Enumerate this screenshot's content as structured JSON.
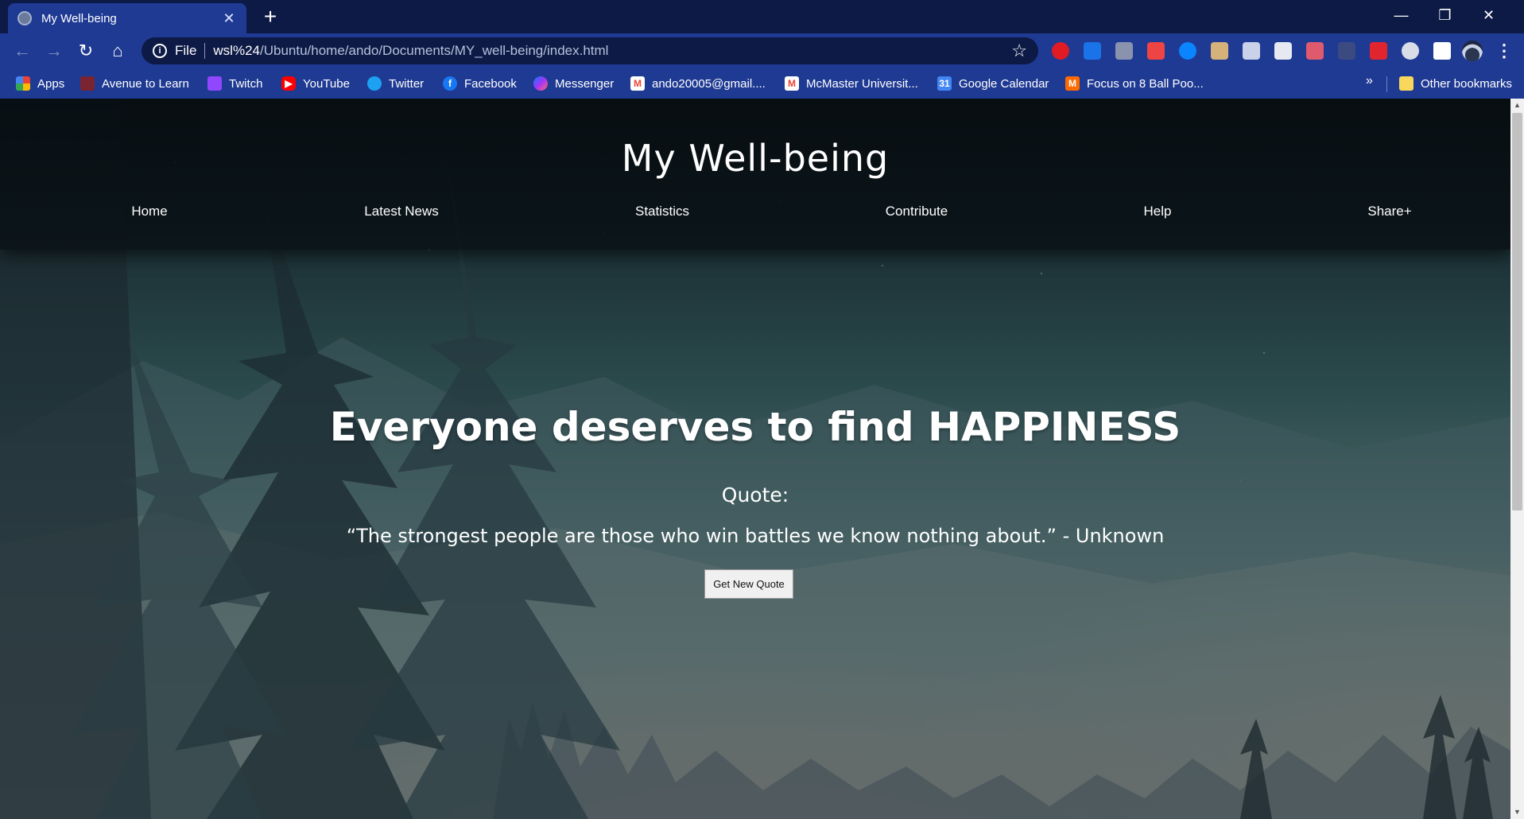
{
  "browser": {
    "tab_title": "My Well-being",
    "new_tab_symbol": "+",
    "url": {
      "scheme_label": "File",
      "host": "wsl%24",
      "path": "/Ubuntu/home/ando/Documents/MY_well-being/index.html"
    },
    "window_controls": {
      "minimize": "—",
      "restore": "❐",
      "close": "✕"
    },
    "bookmarks": [
      {
        "label": "Apps",
        "icon": "apps-grid-icon",
        "color": "#e8453c"
      },
      {
        "label": "Avenue to Learn",
        "icon": "avenue-icon",
        "color": "#7a2432"
      },
      {
        "label": "Twitch",
        "icon": "twitch-icon",
        "color": "#9146ff"
      },
      {
        "label": "YouTube",
        "icon": "youtube-icon",
        "color": "#ff0000"
      },
      {
        "label": "Twitter",
        "icon": "twitter-icon",
        "color": "#1da1f2"
      },
      {
        "label": "Facebook",
        "icon": "facebook-icon",
        "color": "#1877f2"
      },
      {
        "label": "Messenger",
        "icon": "messenger-icon",
        "color": "#a334fa"
      },
      {
        "label": "ando20005@gmail....",
        "icon": "gmail-icon",
        "color": "#ea4335"
      },
      {
        "label": "McMaster Universit...",
        "icon": "gmail-icon",
        "color": "#ea4335"
      },
      {
        "label": "Google Calendar",
        "icon": "calendar-icon",
        "color": "#4285f4"
      },
      {
        "label": "Focus on 8 Ball Poo...",
        "icon": "miniclip-icon",
        "color": "#ff6a00"
      }
    ],
    "bookmarks_overflow": "»",
    "other_bookmarks": "Other bookmarks"
  },
  "site": {
    "title": "My Well-being",
    "nav": [
      "Home",
      "Latest News",
      "Statistics",
      "Contribute",
      "Help",
      "Share+"
    ]
  },
  "hero": {
    "heading": "Everyone deserves to find HAPPINESS",
    "quote_label": "Quote:",
    "quote_text": "“The strongest people are those who win battles we know nothing about.” - Unknown",
    "button_label": "Get New Quote"
  }
}
